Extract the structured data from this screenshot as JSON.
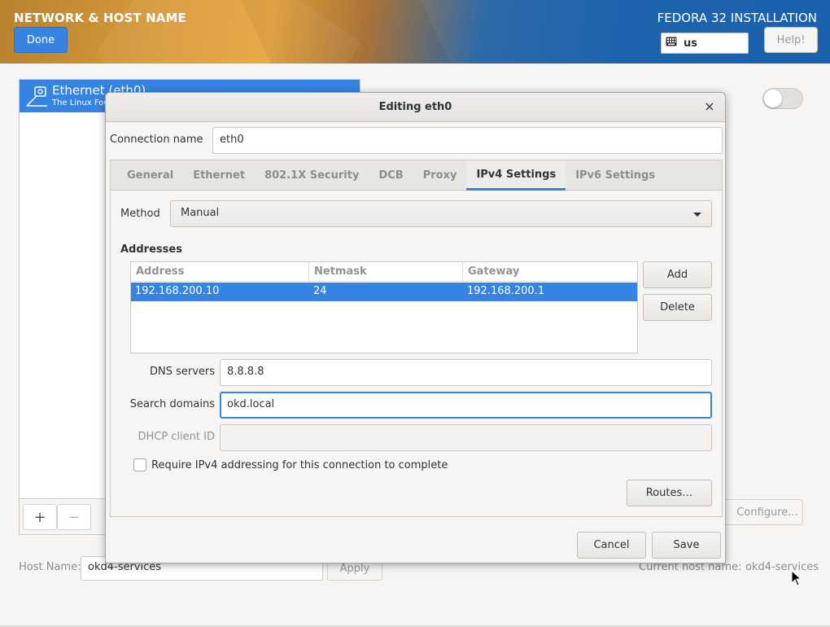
{
  "header": {
    "spoke_title": "NETWORK & HOST NAME",
    "done_label": "Done",
    "product_title": "FEDORA 32 INSTALLATION",
    "keyboard_layout": "us",
    "help_label": "Help!"
  },
  "devices": {
    "items": [
      {
        "name": "Ethernet (eth0)",
        "vendor": "The Linux Fou"
      }
    ],
    "add_label": "+",
    "remove_label": "−"
  },
  "device_panel": {
    "enabled": false,
    "configure_label": "Configure..."
  },
  "hostname": {
    "label": "Host Name:",
    "value": "okd4-services",
    "apply_label": "Apply",
    "current_label": "Current host name:",
    "current_value": "okd4-services"
  },
  "dialog": {
    "title": "Editing eth0",
    "close_glyph": "×",
    "connection_name_label": "Connection name",
    "connection_name_value": "eth0",
    "tabs": [
      "General",
      "Ethernet",
      "802.1X Security",
      "DCB",
      "Proxy",
      "IPv4 Settings",
      "IPv6 Settings"
    ],
    "active_tab": "IPv4 Settings",
    "method_label": "Method",
    "method_value": "Manual",
    "addresses_title": "Addresses",
    "address_columns": [
      "Address",
      "Netmask",
      "Gateway"
    ],
    "address_rows": [
      {
        "address": "192.168.200.10",
        "netmask": "24",
        "gateway": "192.168.200.1"
      }
    ],
    "add_label": "Add",
    "delete_label": "Delete",
    "dns_label": "DNS servers",
    "dns_value": "8.8.8.8",
    "search_label": "Search domains",
    "search_value": "okd.local",
    "dhcp_label": "DHCP client ID",
    "dhcp_value": "",
    "require_ipv4_label": "Require IPv4 addressing for this connection to complete",
    "require_ipv4_checked": false,
    "routes_label": "Routes…",
    "cancel_label": "Cancel",
    "save_label": "Save"
  },
  "colors": {
    "accent": "#3584e4",
    "header_blue": "#1a62ae",
    "header_orange": "#e8a43b"
  }
}
